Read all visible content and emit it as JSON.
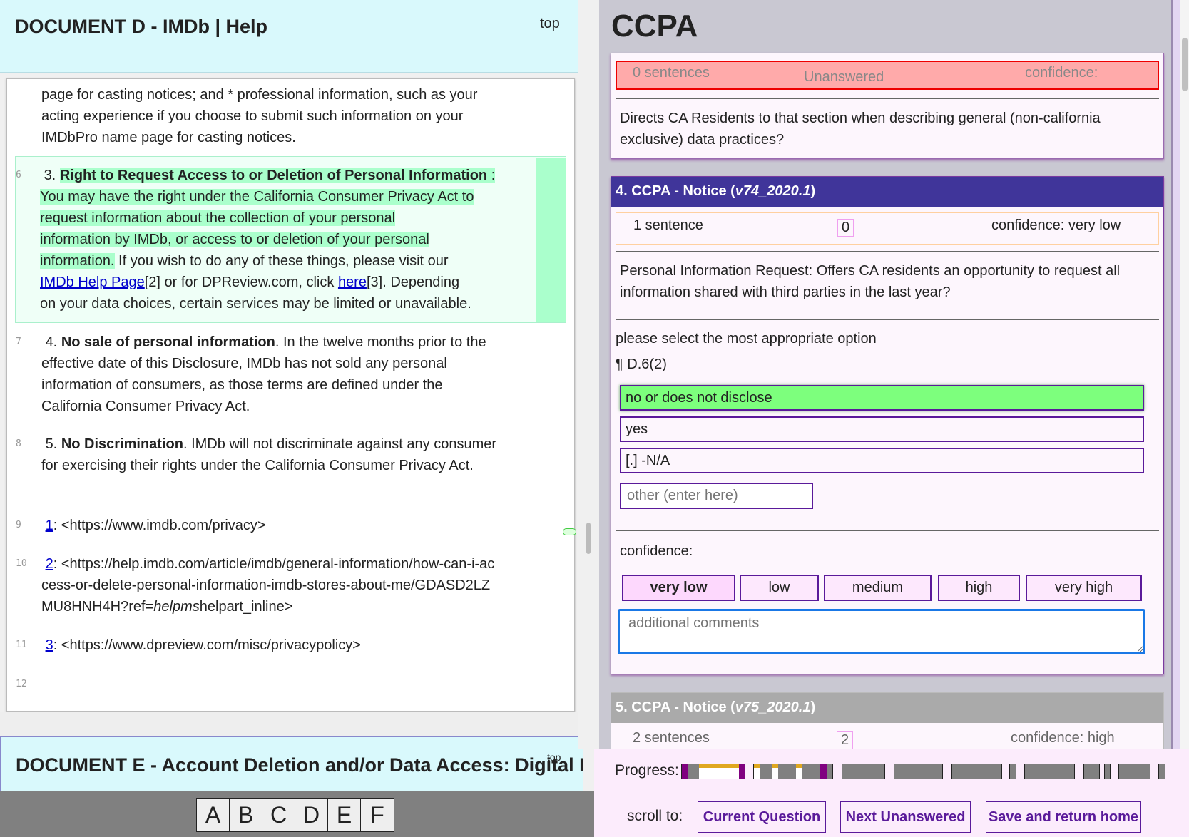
{
  "left": {
    "title": "DOCUMENT D - IMDb | Help",
    "top_link": "top",
    "paragraphs": [
      {
        "lines": [
          "page for casting notices; and * professional information, such as your",
          "acting experience if you choose to submit such information on your",
          "IMDbPro name page for casting notices."
        ]
      },
      {
        "num": "6",
        "prefix": "3. ",
        "bold": "Right to Request Access to or Deletion of Personal Information",
        "colon": " :",
        "hl_lines": [
          "You may have the right under the California Consumer Privacy Act to",
          "request information about the collection of your personal",
          "information by IMDb, or access to or deletion of your personal"
        ],
        "hl_last": "information.",
        "rest1": " If you wish to do any of these things, please visit our",
        "link1": "IMDb Help Page",
        "after1": "[2] or for DPReview.com, click ",
        "link2": "here",
        "after2": "[3]. Depending",
        "last": "on your data choices, certain services may be limited or unavailable."
      },
      {
        "num": "7",
        "prefix": "4. ",
        "bold": "No sale of personal information",
        "text": ". In the twelve months prior to the effective date of this Disclosure, IMDb has not sold any personal information of consumers, as those terms are defined under the California Consumer Privacy Act."
      },
      {
        "num": "8",
        "prefix": "5. ",
        "bold": "No Discrimination",
        "text": ". IMDb will not discriminate against any consumer for exercising their rights under the California Consumer Privacy Act."
      },
      {
        "num": "9",
        "link": "1",
        "text": ": <https://www.imdb.com/privacy>"
      },
      {
        "num": "10",
        "link": "2",
        "text1": ": <https://help.imdb.com/article/imdb/general-information/how-can-i-access-or-delete-personal-information-imdb-stores-about-me/GDASD2LZMU8HNH4H?ref=",
        "em": "helpms",
        "text2": "helpart_inline>"
      },
      {
        "num": "11",
        "link": "3",
        "text": ": <https://www.dpreview.com/misc/privacypolicy>"
      },
      {
        "num": "12"
      }
    ],
    "next_doc_title": "DOCUMENT E - Account Deletion and/or Data Access: Digital Phot",
    "next_doc_top": "top",
    "letters": [
      "A",
      "B",
      "C",
      "D",
      "E",
      "F"
    ]
  },
  "right": {
    "title": "CCPA",
    "card3": {
      "sentences": "0 sentences",
      "status": "Unanswered",
      "confidence": "confidence:",
      "question": "Directs CA Residents to that section when describing general (non-california exclusive) data practices?"
    },
    "card4": {
      "header": "4. CCPA - Notice (",
      "version": "v74_2020.1",
      "header_end": ")",
      "sentences": "1 sentence",
      "count": "0",
      "confidence": "confidence: very low",
      "question": "Personal Information Request: Offers CA residents an opportunity to request all information shared with third parties in the last year?",
      "prompt": "please select the most appropriate option",
      "ref": "¶ D.6(2)",
      "options": [
        "no or does not disclose",
        "yes",
        "[.] -N/A"
      ],
      "selected_option": 0,
      "other_placeholder": "other (enter here)",
      "confidence_label": "confidence:",
      "levels": [
        "very low",
        "low",
        "medium",
        "high",
        "very high"
      ],
      "selected_level": 0,
      "comments_placeholder": "additional comments"
    },
    "card5": {
      "header": "5. CCPA - Notice (",
      "version": "v75_2020.1",
      "header_end": ")",
      "sentences": "2 sentences",
      "count": "2",
      "confidence": "confidence: high"
    }
  },
  "footer": {
    "progress_label": "Progress:",
    "scroll_label": "scroll to:",
    "buttons": [
      "Current Question",
      "Next Unanswered",
      "Save and return home"
    ],
    "segments": [
      [
        [
          "p",
          1
        ],
        [
          "g",
          2
        ],
        [
          "wf",
          7
        ],
        [
          "p",
          1
        ]
      ],
      [
        [
          "wf",
          1
        ],
        [
          "g",
          2
        ],
        [
          "wf",
          1
        ],
        [
          "g",
          3
        ],
        [
          "wf",
          1
        ],
        [
          "g",
          3
        ],
        [
          "p",
          1
        ],
        [
          "g",
          1
        ]
      ],
      [
        [
          "g",
          1
        ]
      ],
      [
        [
          "g",
          1
        ]
      ],
      [
        [
          "g",
          1
        ]
      ],
      [
        [
          "g",
          1
        ]
      ],
      [
        [
          "g",
          1
        ]
      ],
      [
        [
          "g",
          1
        ]
      ],
      [
        [
          "g",
          1
        ]
      ],
      [
        [
          "g",
          1
        ]
      ],
      [
        [
          "g",
          1
        ]
      ]
    ]
  },
  "colors": {
    "header_bg": "#d9f9fc",
    "highlight": "#aaffcc",
    "card_header": "#40359a",
    "selected_option": "#7dff7d",
    "unanswered": "#ffaaaa",
    "accent": "#5a1a9a"
  }
}
